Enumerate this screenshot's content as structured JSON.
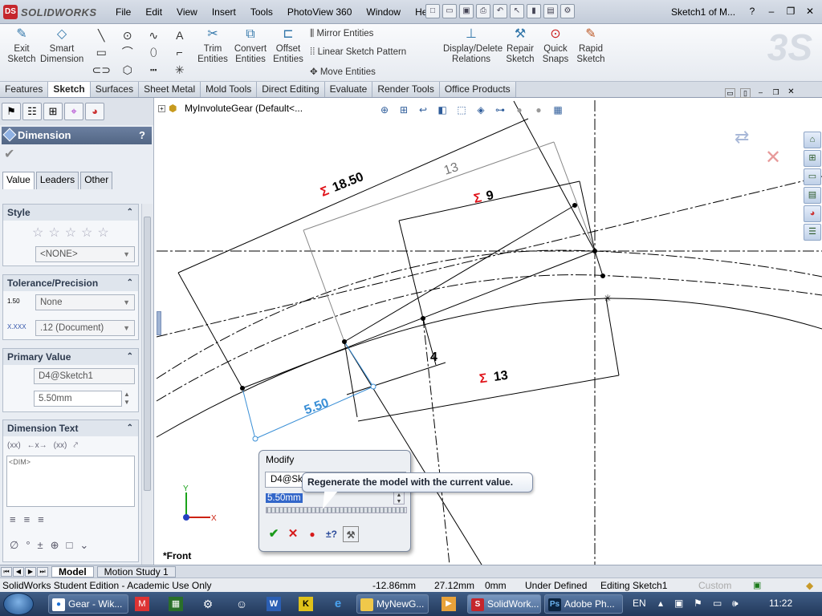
{
  "app": {
    "logo_text": "SOLIDWORKS",
    "document_title": "Sketch1 of M..."
  },
  "menu": [
    "File",
    "Edit",
    "View",
    "Insert",
    "Tools",
    "PhotoView 360",
    "Window",
    "Help"
  ],
  "command_manager": {
    "exit_sketch": "Exit Sketch",
    "smart_dimension": "Smart Dimension",
    "trim": "Trim Entities",
    "convert": "Convert Entities",
    "offset": "Offset Entities",
    "mirror": "Mirror Entities",
    "linear_pattern": "Linear Sketch Pattern",
    "move": "Move Entities",
    "display_delete": "Display/Delete Relations",
    "repair": "Repair Sketch",
    "quick_snaps": "Quick Snaps",
    "rapid_sketch": "Rapid Sketch"
  },
  "tabs": [
    "Features",
    "Sketch",
    "Surfaces",
    "Sheet Metal",
    "Mold Tools",
    "Direct Editing",
    "Evaluate",
    "Render Tools",
    "Office Products"
  ],
  "active_tab": "Sketch",
  "property_manager": {
    "title": "Dimension",
    "help": "?",
    "subtabs": [
      "Value",
      "Leaders",
      "Other"
    ],
    "style": {
      "heading": "Style",
      "value": "<NONE>"
    },
    "tolerance": {
      "heading": "Tolerance/Precision",
      "tolerance_type": "None",
      "precision": ".12 (Document)",
      "tol_icon_text": "1.50",
      "prec_icon_text": "X.XXX"
    },
    "primary_value": {
      "heading": "Primary Value",
      "name": "D4@Sketch1",
      "value": "5.50mm"
    },
    "dimension_text": {
      "heading": "Dimension Text",
      "text": "<DIM>",
      "buttons": [
        "(xx)",
        "←x→",
        "(xx)"
      ]
    }
  },
  "graphics": {
    "tree_label": "MyInvoluteGear  (Default<...",
    "view_label": "*Front",
    "dims": {
      "d1": "18.50",
      "d2": "13",
      "d3": "9",
      "d4": "4",
      "d5": "13",
      "d6": "5.50",
      "sigma": "Σ"
    }
  },
  "modify": {
    "title": "Modify",
    "name": "D4@Sketch1",
    "value": "5.50mm",
    "tooltip": "Regenerate the model with the current value."
  },
  "bottom_tabs": [
    "Model",
    "Motion Study 1"
  ],
  "status": {
    "edition": "SolidWorks Student Edition - Academic Use Only",
    "x": "-12.86mm",
    "y": "27.12mm",
    "z": "0mm",
    "state": "Under Defined",
    "editing": "Editing Sketch1",
    "units": "Custom"
  },
  "taskbar": {
    "items": [
      "Gear - Wik...",
      "MyNewG...",
      "SolidWork...",
      "Adobe Ph..."
    ],
    "lang": "EN",
    "time": "11:22"
  },
  "colors": {
    "accent": "#526684",
    "sigma": "#e0131a",
    "selected_dim": "#3a8fd6"
  }
}
